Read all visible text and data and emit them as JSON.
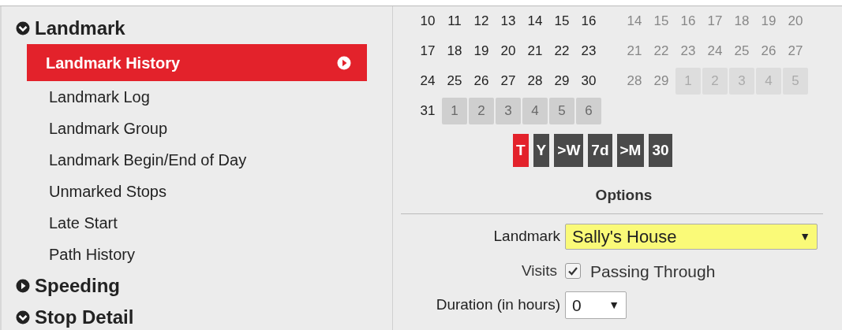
{
  "sidebar": {
    "sections": [
      {
        "label": "Landmark",
        "expanded": true,
        "items": [
          {
            "label": "Landmark History",
            "selected": true
          },
          {
            "label": "Landmark Log",
            "selected": false
          },
          {
            "label": "Landmark Group",
            "selected": false
          },
          {
            "label": "Landmark Begin/End of Day",
            "selected": false
          },
          {
            "label": "Unmarked Stops",
            "selected": false
          },
          {
            "label": "Late Start",
            "selected": false
          },
          {
            "label": "Path History",
            "selected": false
          }
        ]
      },
      {
        "label": "Speeding",
        "expanded": false
      },
      {
        "label": "Stop Detail",
        "expanded": true
      }
    ]
  },
  "calendars": [
    {
      "disabled": false,
      "weeks": [
        [
          {
            "day": "10",
            "outside": false
          },
          {
            "day": "11",
            "outside": false
          },
          {
            "day": "12",
            "outside": false
          },
          {
            "day": "13",
            "outside": false
          },
          {
            "day": "14",
            "outside": false
          },
          {
            "day": "15",
            "outside": false
          },
          {
            "day": "16",
            "outside": false
          }
        ],
        [
          {
            "day": "17",
            "outside": false
          },
          {
            "day": "18",
            "outside": false
          },
          {
            "day": "19",
            "outside": false
          },
          {
            "day": "20",
            "outside": false
          },
          {
            "day": "21",
            "outside": false
          },
          {
            "day": "22",
            "outside": false
          },
          {
            "day": "23",
            "outside": false
          }
        ],
        [
          {
            "day": "24",
            "outside": false
          },
          {
            "day": "25",
            "outside": false
          },
          {
            "day": "26",
            "outside": false
          },
          {
            "day": "27",
            "outside": false
          },
          {
            "day": "28",
            "outside": false
          },
          {
            "day": "29",
            "outside": false
          },
          {
            "day": "30",
            "outside": false
          }
        ],
        [
          {
            "day": "31",
            "outside": false
          },
          {
            "day": "1",
            "outside": true
          },
          {
            "day": "2",
            "outside": true
          },
          {
            "day": "3",
            "outside": true
          },
          {
            "day": "4",
            "outside": true
          },
          {
            "day": "5",
            "outside": true
          },
          {
            "day": "6",
            "outside": true
          }
        ]
      ]
    },
    {
      "disabled": true,
      "weeks": [
        [
          {
            "day": "14",
            "outside": false
          },
          {
            "day": "15",
            "outside": false
          },
          {
            "day": "16",
            "outside": false
          },
          {
            "day": "17",
            "outside": false
          },
          {
            "day": "18",
            "outside": false
          },
          {
            "day": "19",
            "outside": false
          },
          {
            "day": "20",
            "outside": false
          }
        ],
        [
          {
            "day": "21",
            "outside": false
          },
          {
            "day": "22",
            "outside": false
          },
          {
            "day": "23",
            "outside": false
          },
          {
            "day": "24",
            "outside": false
          },
          {
            "day": "25",
            "outside": false
          },
          {
            "day": "26",
            "outside": false
          },
          {
            "day": "27",
            "outside": false
          }
        ],
        [
          {
            "day": "28",
            "outside": false
          },
          {
            "day": "29",
            "outside": false
          },
          {
            "day": "1",
            "outside": true
          },
          {
            "day": "2",
            "outside": true
          },
          {
            "day": "3",
            "outside": true
          },
          {
            "day": "4",
            "outside": true
          },
          {
            "day": "5",
            "outside": true
          }
        ]
      ]
    }
  ],
  "quick_ranges": [
    {
      "label": "T",
      "selected": true
    },
    {
      "label": "Y",
      "selected": false
    },
    {
      "label": ">W",
      "selected": false
    },
    {
      "label": "7d",
      "selected": false
    },
    {
      "label": ">M",
      "selected": false
    },
    {
      "label": "30",
      "selected": false
    }
  ],
  "options": {
    "title": "Options",
    "landmark": {
      "label": "Landmark",
      "value": "Sally's House",
      "caret": "▼"
    },
    "visits": {
      "label": "Visits",
      "checked": true,
      "option": "Passing Through"
    },
    "duration": {
      "label": "Duration (in hours)",
      "value": "0",
      "caret": "▼"
    }
  }
}
